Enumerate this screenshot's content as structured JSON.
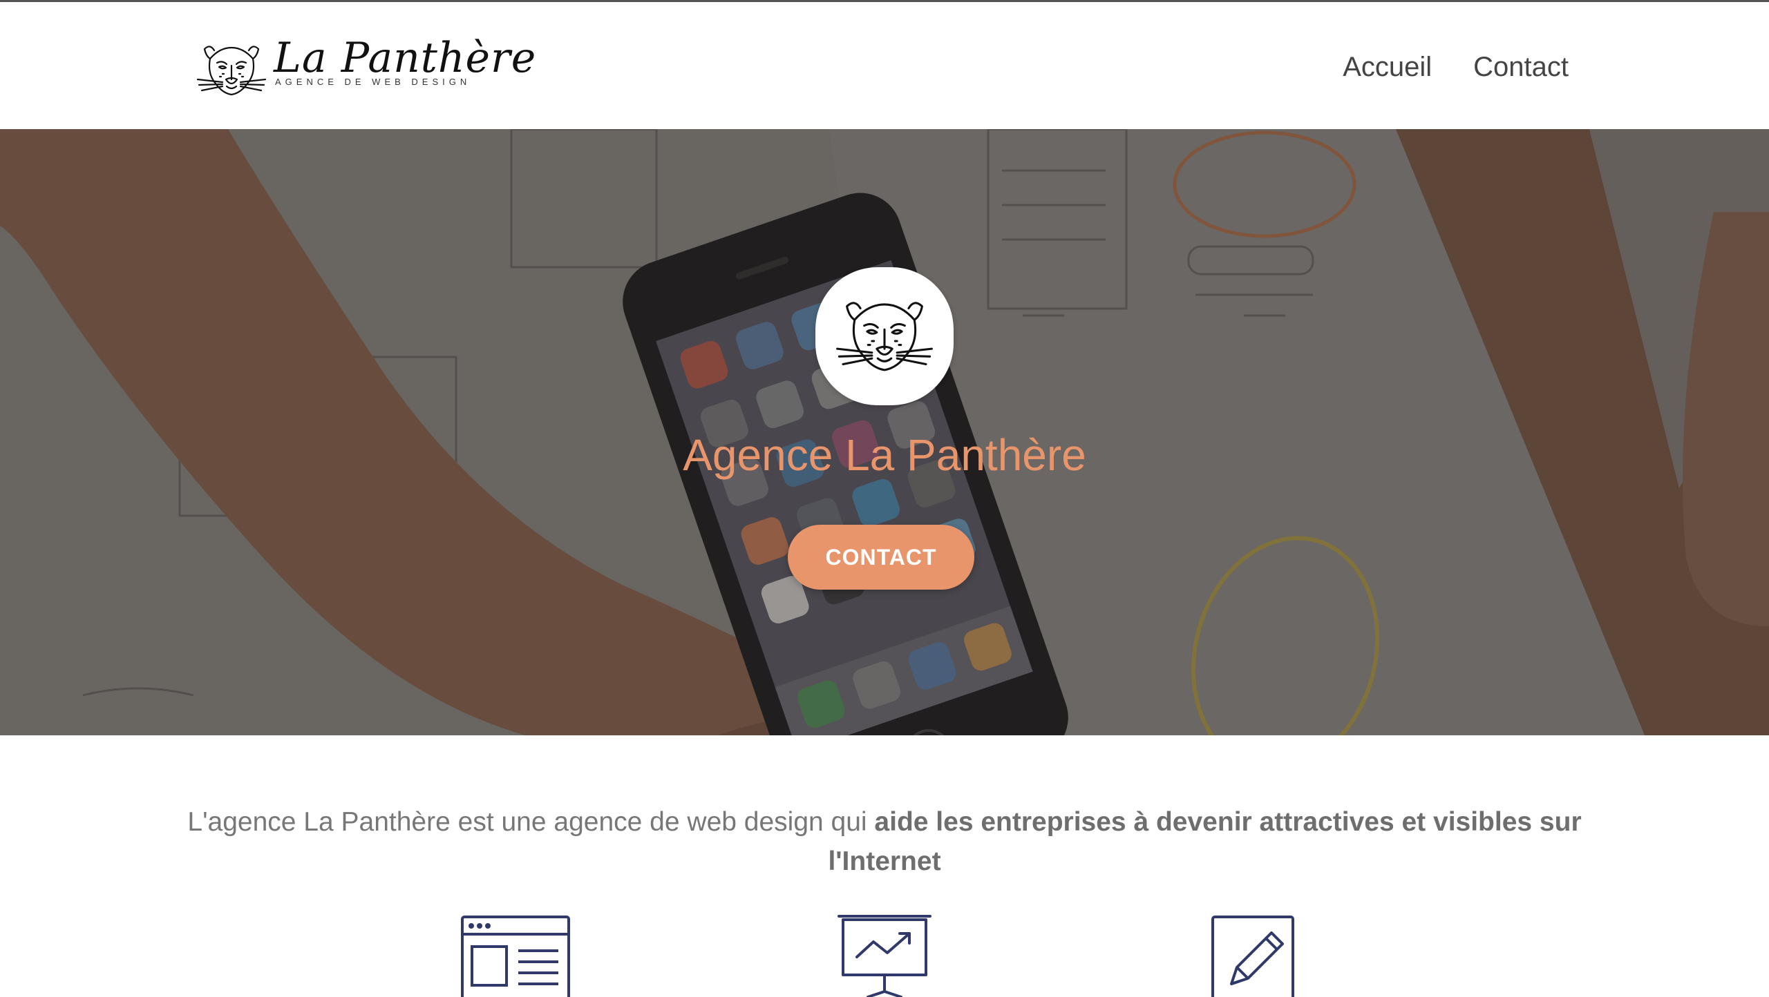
{
  "header": {
    "logo_title": "La Panthère",
    "logo_subtitle": "AGENCE DE WEB DESIGN",
    "nav": [
      {
        "label": "Accueil"
      },
      {
        "label": "Contact"
      }
    ]
  },
  "hero": {
    "title": "Agence La Panthère",
    "cta_label": "CONTACT",
    "badge_icon": "panther-head-icon"
  },
  "intro": {
    "text_plain": "L'agence La Panthère est une agence de web design qui ",
    "text_bold": "aide les entreprises à devenir attractives et visibles sur l'Internet"
  },
  "features": {
    "icons": [
      "website-layout-icon",
      "presentation-chart-icon",
      "pencil-edit-icon"
    ]
  },
  "colors": {
    "accent": "#e8956b",
    "icon_navy": "#2f3a6b",
    "text_gray": "#777777"
  }
}
